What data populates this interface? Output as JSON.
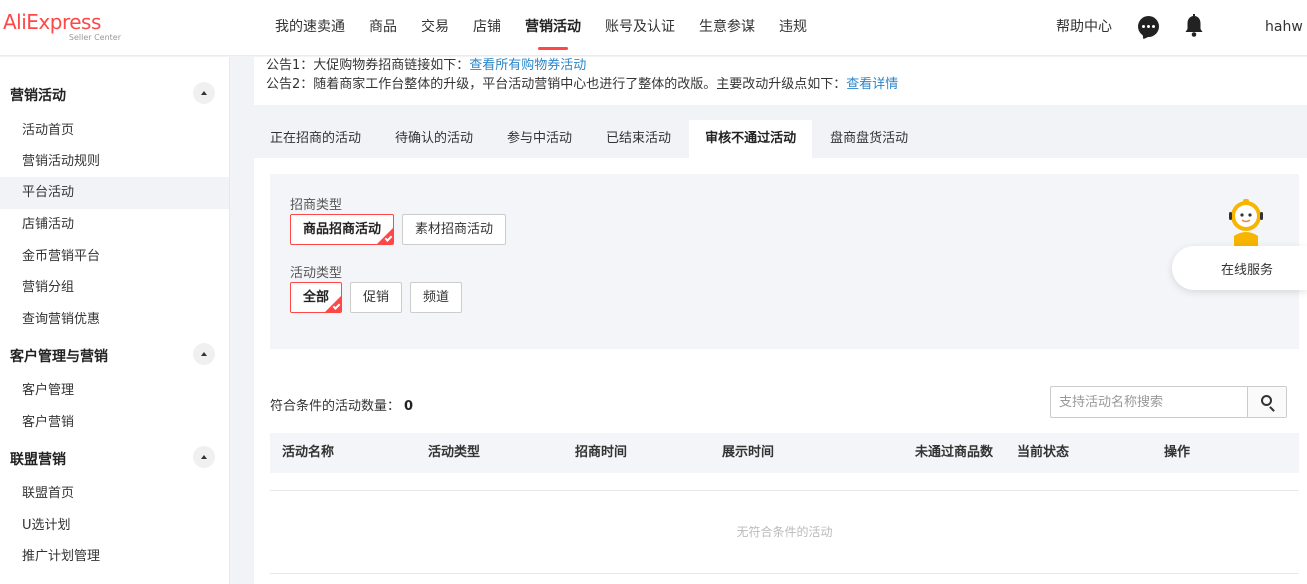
{
  "header": {
    "logo": {
      "brand": "AliExpress",
      "sub": "Seller Center"
    },
    "nav": [
      {
        "label": "我的速卖通",
        "active": false
      },
      {
        "label": "商品",
        "active": false
      },
      {
        "label": "交易",
        "active": false
      },
      {
        "label": "店铺",
        "active": false
      },
      {
        "label": "营销活动",
        "active": true
      },
      {
        "label": "账号及认证",
        "active": false
      },
      {
        "label": "生意参谋",
        "active": false
      },
      {
        "label": "违规",
        "active": false
      }
    ],
    "help": "帮助中心",
    "icons": {
      "chat": "chat-icon",
      "notify": "bell-icon"
    },
    "user": "hahw"
  },
  "sidebar": {
    "groups": [
      {
        "title": "营销活动",
        "items": [
          "活动首页",
          "营销活动规则",
          "平台活动",
          "店铺活动",
          "金币营销平台",
          "营销分组",
          "查询营销优惠"
        ]
      },
      {
        "title": "客户管理与营销",
        "items": [
          "客户管理",
          "客户营销"
        ]
      },
      {
        "title": "联盟营销",
        "items": [
          "联盟首页",
          "U选计划",
          "推广计划管理"
        ]
      }
    ],
    "active_item": "平台活动"
  },
  "notice": {
    "line1_text": "公告1：大促购物券招商链接如下：",
    "line1_link": "查看所有购物券活动",
    "line2_text": "公告2：随着商家工作台整体的升级，平台活动营销中心也进行了整体的改版。主要改动升级点如下：",
    "line2_link": "查看详情"
  },
  "tabs": [
    {
      "label": "正在招商的活动",
      "active": false
    },
    {
      "label": "待确认的活动",
      "active": false
    },
    {
      "label": "参与中活动",
      "active": false
    },
    {
      "label": "已结束活动",
      "active": false
    },
    {
      "label": "审核不通过活动",
      "active": true
    },
    {
      "label": "盘商盘货活动",
      "active": false
    }
  ],
  "filters": {
    "recruit_type": {
      "label": "招商类型",
      "options": [
        {
          "label": "商品招商活动",
          "selected": true
        },
        {
          "label": "素材招商活动",
          "selected": false
        }
      ]
    },
    "activity_type": {
      "label": "活动类型",
      "options": [
        {
          "label": "全部",
          "selected": true
        },
        {
          "label": "促销",
          "selected": false
        },
        {
          "label": "频道",
          "selected": false
        }
      ]
    }
  },
  "results": {
    "count_label": "符合条件的活动数量：",
    "count": "0",
    "search_placeholder": "支持活动名称搜索"
  },
  "table": {
    "columns": [
      "活动名称",
      "活动类型",
      "招商时间",
      "展示时间",
      "未通过商品数",
      "当前状态",
      "操作"
    ],
    "rows": [],
    "empty_text": "无符合条件的活动"
  },
  "service": {
    "label": "在线服务"
  },
  "colors": {
    "accent": "#ff4747",
    "link": "#2b86c8",
    "page_bg": "#f2f3f7"
  }
}
